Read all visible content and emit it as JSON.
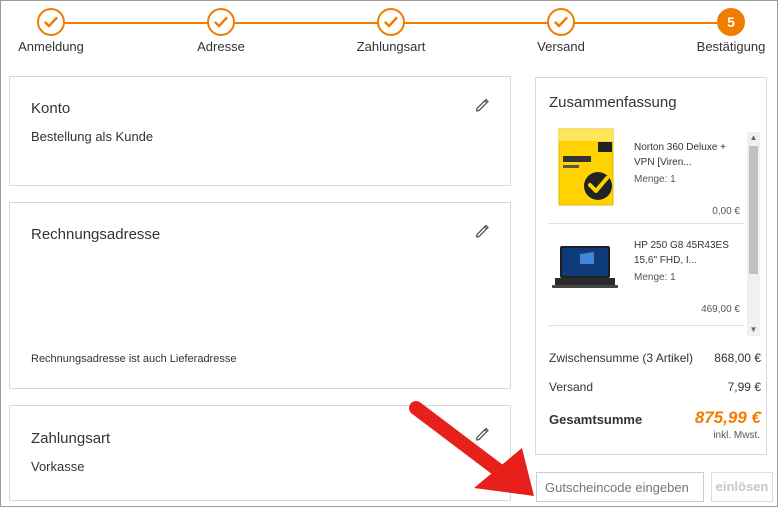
{
  "stepper": {
    "steps": [
      {
        "label": "Anmeldung",
        "state": "done"
      },
      {
        "label": "Adresse",
        "state": "done"
      },
      {
        "label": "Zahlungsart",
        "state": "done"
      },
      {
        "label": "Versand",
        "state": "done"
      },
      {
        "label": "Bestätigung",
        "state": "active",
        "number": "5"
      }
    ]
  },
  "konto": {
    "title": "Konto",
    "text": "Bestellung als Kunde"
  },
  "rechnung": {
    "title": "Rechnungsadresse",
    "text": "Rechnungsadresse ist auch Lieferadresse"
  },
  "zahlung": {
    "title": "Zahlungsart",
    "text": "Vorkasse"
  },
  "summary": {
    "title": "Zusammenfassung",
    "items": [
      {
        "name": "Norton 360 Deluxe + VPN [Viren...",
        "qty": "Menge: 1",
        "price": "0,00 €",
        "image": "norton-box-icon"
      },
      {
        "name": "HP 250 G8 45R43ES 15,6\" FHD, I...",
        "qty": "Menge: 1",
        "price": "469,00 €",
        "image": "laptop-icon"
      }
    ],
    "subtotal_label": "Zwischensumme (3 Artikel)",
    "subtotal_value": "868,00 €",
    "shipping_label": "Versand",
    "shipping_value": "7,99 €",
    "total_label": "Gesamtsumme",
    "total_value": "875,99 €",
    "tax_note": "inkl. Mwst."
  },
  "coupon": {
    "placeholder": "Gutscheincode eingeben",
    "button": "einlösen"
  },
  "colors": {
    "accent": "#f07d00",
    "annotation_arrow": "#e8201c"
  }
}
